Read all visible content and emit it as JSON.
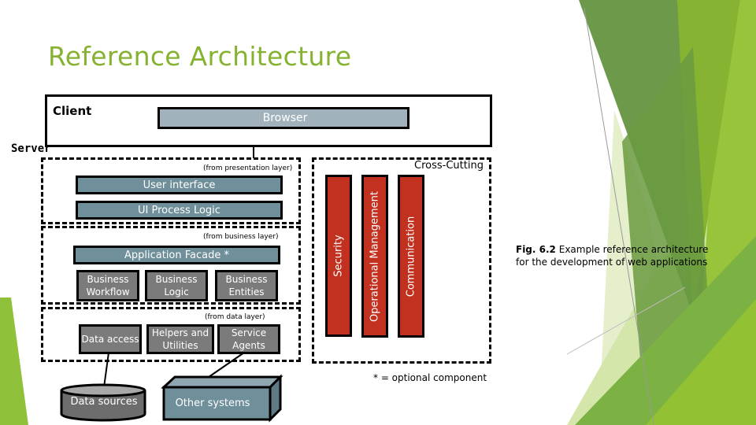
{
  "slide": {
    "title": "Reference Architecture",
    "theme_colors": {
      "title_green": "#86b231",
      "browser_fill": "#a1b2bd",
      "layer_fill": "#6f8f9a",
      "component_fill": "#7b7b7b",
      "crosscut_fill": "#c2311f"
    }
  },
  "diagram": {
    "client": {
      "label": "Client",
      "browser_label": "Browser"
    },
    "server": {
      "label": "Server",
      "presentation_layer": {
        "note": "(from presentation layer)",
        "components": [
          "User interface",
          "UI Process Logic"
        ]
      },
      "business_layer": {
        "note": "(from business layer)",
        "facade": "Application Facade *",
        "components": [
          "Business Workflow",
          "Business Logic",
          "Business Entities"
        ]
      },
      "data_layer": {
        "note": "(from data layer)",
        "components": [
          "Data access",
          "Helpers and Utilities",
          "Service Agents"
        ]
      },
      "cross_cutting": {
        "label": "Cross-Cutting",
        "components": [
          "Security",
          "Operational Management",
          "Communication"
        ]
      }
    },
    "external": {
      "data_sources": "Data sources",
      "other_systems": "Other systems"
    },
    "legend_note": "* = optional component"
  },
  "caption": {
    "fig_label": "Fig. 6.2",
    "text": "Example reference architecture for the development of web applications"
  }
}
